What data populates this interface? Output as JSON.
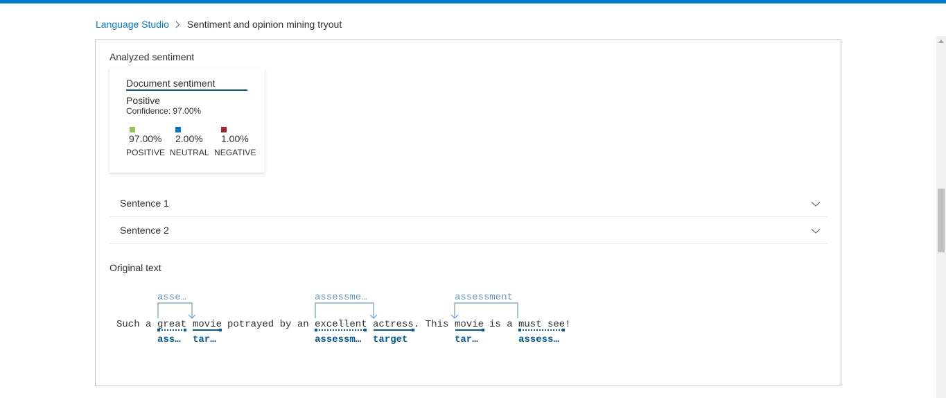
{
  "breadcrumb": {
    "root": "Language Studio",
    "current": "Sentiment and opinion mining tryout"
  },
  "analyzed": {
    "title": "Analyzed sentiment",
    "card": {
      "title": "Document sentiment",
      "sentiment": "Positive",
      "confidence": "Confidence: 97.00%",
      "scores": [
        {
          "value": "97.00%",
          "label": "POSITIVE",
          "color": "#92c353"
        },
        {
          "value": "2.00%",
          "label": "NEUTRAL",
          "color": "#0078d4"
        },
        {
          "value": "1.00%",
          "label": "NEGATIVE",
          "color": "#a4262c"
        }
      ]
    }
  },
  "sentences": [
    {
      "label": "Sentence 1"
    },
    {
      "label": "Sentence 2"
    }
  ],
  "original": {
    "title": "Original text",
    "tokens": [
      {
        "text": "Such a ",
        "role": null
      },
      {
        "text": "great",
        "role": "assessment",
        "label": "ass…",
        "link_label": "asse…"
      },
      {
        "text": " ",
        "role": null
      },
      {
        "text": "movie",
        "role": "target",
        "label": "tar…"
      },
      {
        "text": " potrayed by an ",
        "role": null
      },
      {
        "text": "excellent",
        "role": "assessment",
        "label": "assessm…",
        "link_label": "assessme…"
      },
      {
        "text": " ",
        "role": null
      },
      {
        "text": "actress",
        "role": "target",
        "label": "target"
      },
      {
        "text": ". This ",
        "role": null
      },
      {
        "text": "movie",
        "role": "target",
        "label": "tar…",
        "link_label": "assessment"
      },
      {
        "text": " is a ",
        "role": null
      },
      {
        "text": "must see",
        "role": "assessment",
        "label": "assess…"
      },
      {
        "text": "!",
        "role": null
      }
    ]
  },
  "colors": {
    "accent": "#0078d4",
    "annotation": "#005a9e",
    "link": "#6a9bc8"
  }
}
